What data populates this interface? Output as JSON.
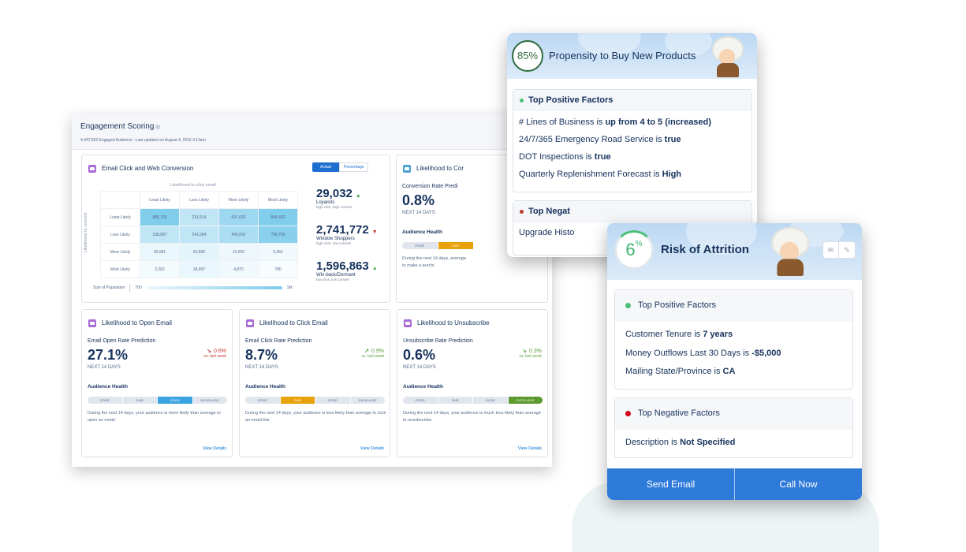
{
  "dashboard": {
    "title": "Engagement Scoring",
    "subtitle": "4,497,832 Engaged Audience - Last updated on August 4, 2016 4:13am",
    "main_card": {
      "title": "Email Click and Web Conversion",
      "toggle": [
        "Actual",
        "Percentage"
      ],
      "x_axis_label": "Likelihood to click email",
      "y_axis_label": "Likelihood to convert",
      "columns": [
        "Least Likely",
        "Less Likely",
        "More Likely",
        "Most Likely"
      ],
      "rows": [
        {
          "label": "Least Likely",
          "values": [
            "885,768",
            "231,914",
            "697,692",
            "845,432"
          ],
          "intensity": [
            0.9,
            0.45,
            0.7,
            0.9
          ]
        },
        {
          "label": "Less Likely",
          "values": [
            "238,087",
            "241,084",
            "409,892",
            "788,756"
          ],
          "intensity": [
            0.45,
            0.45,
            0.6,
            0.85
          ]
        },
        {
          "label": "More Likely",
          "values": [
            "30,081",
            "62,895",
            "13,920",
            "9,462"
          ],
          "intensity": [
            0.15,
            0.2,
            0.12,
            0.1
          ]
        },
        {
          "label": "Most Likely",
          "values": [
            "2,282",
            "34,907",
            "4,870",
            "780"
          ],
          "intensity": [
            0.08,
            0.15,
            0.1,
            0.05
          ]
        }
      ],
      "legend": {
        "label": "Size of Population",
        "min": "700",
        "max": "1M"
      },
      "stats": [
        {
          "value": "29,032",
          "trend": "up",
          "label": "Loyalists",
          "sub": "high click, high convert"
        },
        {
          "value": "2,741,772",
          "trend": "down",
          "label": "Window Shoppers",
          "sub": "high click, low convert"
        },
        {
          "value": "1,596,863",
          "trend": "up",
          "label": "Win-back/Dormant",
          "sub": "low click, low convert"
        }
      ]
    },
    "conversion_card": {
      "title": "Likelihood to Cor",
      "subtitle": "Conversion Rate Predi",
      "value": "0.8%",
      "period": "NEXT 14 DAYS",
      "health_label": "Audience Health",
      "health_levels": [
        "POOR",
        "FAIR"
      ],
      "desc": "During the next 14 days, average to make a purchi"
    },
    "small_cards": [
      {
        "title": "Likelihood to Open Email",
        "subtitle": "Email Open Rate Prediction",
        "value": "27.1%",
        "period": "NEXT 14 DAYS",
        "delta": "0.6%",
        "delta_dir": "down",
        "delta_color": "#c23934",
        "delta_sub": "vs. last week",
        "health_label": "Audience Health",
        "health_levels": [
          "POOR",
          "FAIR",
          "GOOD",
          "EXCELLENT"
        ],
        "health_active": 2,
        "active_color": "#3ba3e0",
        "desc": "During the next 14 days, your audience is more likely than average to open an email.",
        "link": "View Details"
      },
      {
        "title": "Likelihood to Click Email",
        "subtitle": "Email Click Rate Prediction",
        "value": "8.7%",
        "period": "NEXT 14 DAYS",
        "delta": "0.9%",
        "delta_dir": "up",
        "delta_color": "#5aa33b",
        "delta_sub": "vs. last week",
        "health_label": "Audience Health",
        "health_levels": [
          "POOR",
          "FAIR",
          "GOOD",
          "EXCELLENT"
        ],
        "health_active": 1,
        "active_color": "#e8a20c",
        "desc": "During the next 14 days, your audience is less likely than average to click an email link.",
        "link": "View Details"
      },
      {
        "title": "Likelihood to Unsubscribe",
        "subtitle": "Unsubscribe Rate Prediction",
        "value": "0.6%",
        "period": "NEXT 14 DAYS",
        "delta": "0.3%",
        "delta_dir": "down",
        "delta_color": "#5aa33b",
        "delta_sub": "vs. last week",
        "health_label": "Audience Health",
        "health_levels": [
          "POOR",
          "FAIR",
          "GOOD",
          "EXCELLENT"
        ],
        "health_active": 3,
        "active_color": "#5c9a2e",
        "desc": "During the next 14 days, your audience is much less likely than average to unsubscribe.",
        "link": "View Details"
      }
    ]
  },
  "propensity": {
    "score": "85%",
    "title": "Propensity to Buy New Products",
    "positive_title": "Top Positive Factors",
    "positive": [
      {
        "text": "# Lines of Business is ",
        "bold": "up from 4 to 5 (increased)"
      },
      {
        "text": "24/7/365 Emergency Road Service is ",
        "bold": "true"
      },
      {
        "text": "DOT Inspections is ",
        "bold": "true"
      },
      {
        "text": "Quarterly Replenishment Forecast is ",
        "bold": "High"
      }
    ],
    "negative_title": "Top Negat",
    "negative": [
      "Upgrade Histo"
    ]
  },
  "attrition": {
    "score": "6",
    "score_unit": "%",
    "title": "Risk of Attrition",
    "positive_title": "Top Positive Factors",
    "positive": [
      {
        "text": "Customer Tenure is ",
        "bold": "7 years"
      },
      {
        "text": "Money Outflows Last 30 Days is ",
        "bold": "-$5,000"
      },
      {
        "text": "Mailing State/Province is ",
        "bold": "CA"
      }
    ],
    "negative_title": "Top Negative Factors",
    "negative": [
      {
        "text": "Description is ",
        "bold": "Not Specified"
      }
    ],
    "buttons": [
      "Send Email",
      "Call Now"
    ]
  },
  "colors": {
    "primary": "#2e7ad9",
    "positive": "#4bc076",
    "negative": "#c23934",
    "purple": "#a96bd6"
  }
}
